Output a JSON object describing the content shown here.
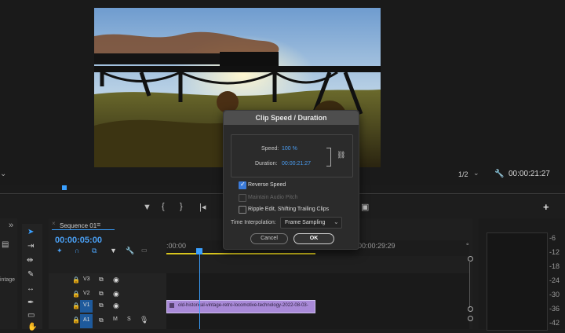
{
  "monitor": {
    "fraction": "1/2",
    "timecode": "00:00:21:27"
  },
  "sequence": {
    "name": "Sequence 01",
    "timecode": "00:00:05:00",
    "ruler_start": ":00:00",
    "ruler_mark": "00:00:29:29"
  },
  "tracks": [
    {
      "name": "V3"
    },
    {
      "name": "V2"
    },
    {
      "name": "V1"
    },
    {
      "name": "A1"
    }
  ],
  "clip": {
    "label": "old-historical-vintage-retro-locomotive-technology-2022-08-03-"
  },
  "left_panel": {
    "text": "intage"
  },
  "meter_scale": [
    "-6",
    "-12",
    "-18",
    "-24",
    "-30",
    "-36",
    "-42"
  ],
  "dialog": {
    "title": "Clip Speed / Duration",
    "speed_label": "Speed:",
    "speed_value": "100 %",
    "duration_label": "Duration:",
    "duration_value": "00:00:21:27",
    "reverse_speed": "Reverse Speed",
    "maintain_audio": "Maintain Audio Pitch",
    "ripple_edit": "Ripple Edit, Shifting Trailing Clips",
    "interp_label": "Time Interpolation:",
    "interp_value": "Frame Sampling",
    "cancel": "Cancel",
    "ok": "OK",
    "reverse_checked": true,
    "maintain_checked": false,
    "ripple_checked": false
  },
  "colors": {
    "accent": "#3b7bd9",
    "clip": "#a98ad8",
    "playhead": "#3aa0ff"
  }
}
